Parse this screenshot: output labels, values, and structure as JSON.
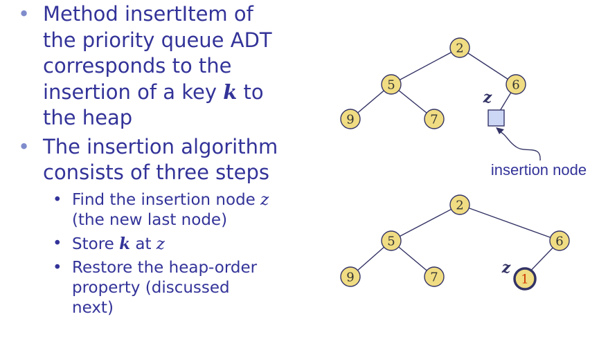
{
  "left_text": {
    "bullet1": {
      "line1": "Method insertItem of",
      "line2": "the priority queue ADT",
      "line3": "corresponds to the",
      "line4a": "insertion of a key ",
      "line4_var": "k",
      "line4b": " to",
      "line5": "the heap"
    },
    "bullet2": {
      "line1": "The insertion algorithm",
      "line2": "consists of three steps"
    },
    "sub1": {
      "line1a": "Find the insertion node ",
      "line1_var": "z",
      "line2": "(the new last node)"
    },
    "sub2": {
      "a": "Store ",
      "k_var": "k",
      "b": " at ",
      "z_var": "z"
    },
    "sub3": {
      "line1": "Restore the heap-order",
      "line2": "property (discussed",
      "line3": "next)"
    }
  },
  "top_heap": {
    "nodes": {
      "root": "2",
      "left": "5",
      "right": "6",
      "left_left": "9",
      "left_right": "7"
    },
    "z_label": "z",
    "annotation": "insertion node"
  },
  "bottom_heap": {
    "nodes": {
      "root": "2",
      "left": "5",
      "right": "6",
      "left_left": "9",
      "left_right": "7",
      "new_node": "1"
    },
    "z_label": "z"
  },
  "colors": {
    "text": "#333399",
    "bullet_dot": "#7f8ccc",
    "node_fill": "#f0dc82",
    "node_stroke": "#333366",
    "insertion_square_fill": "#ccd6f5",
    "new_key_text": "#cc3300",
    "annotation_text": "#333399"
  }
}
